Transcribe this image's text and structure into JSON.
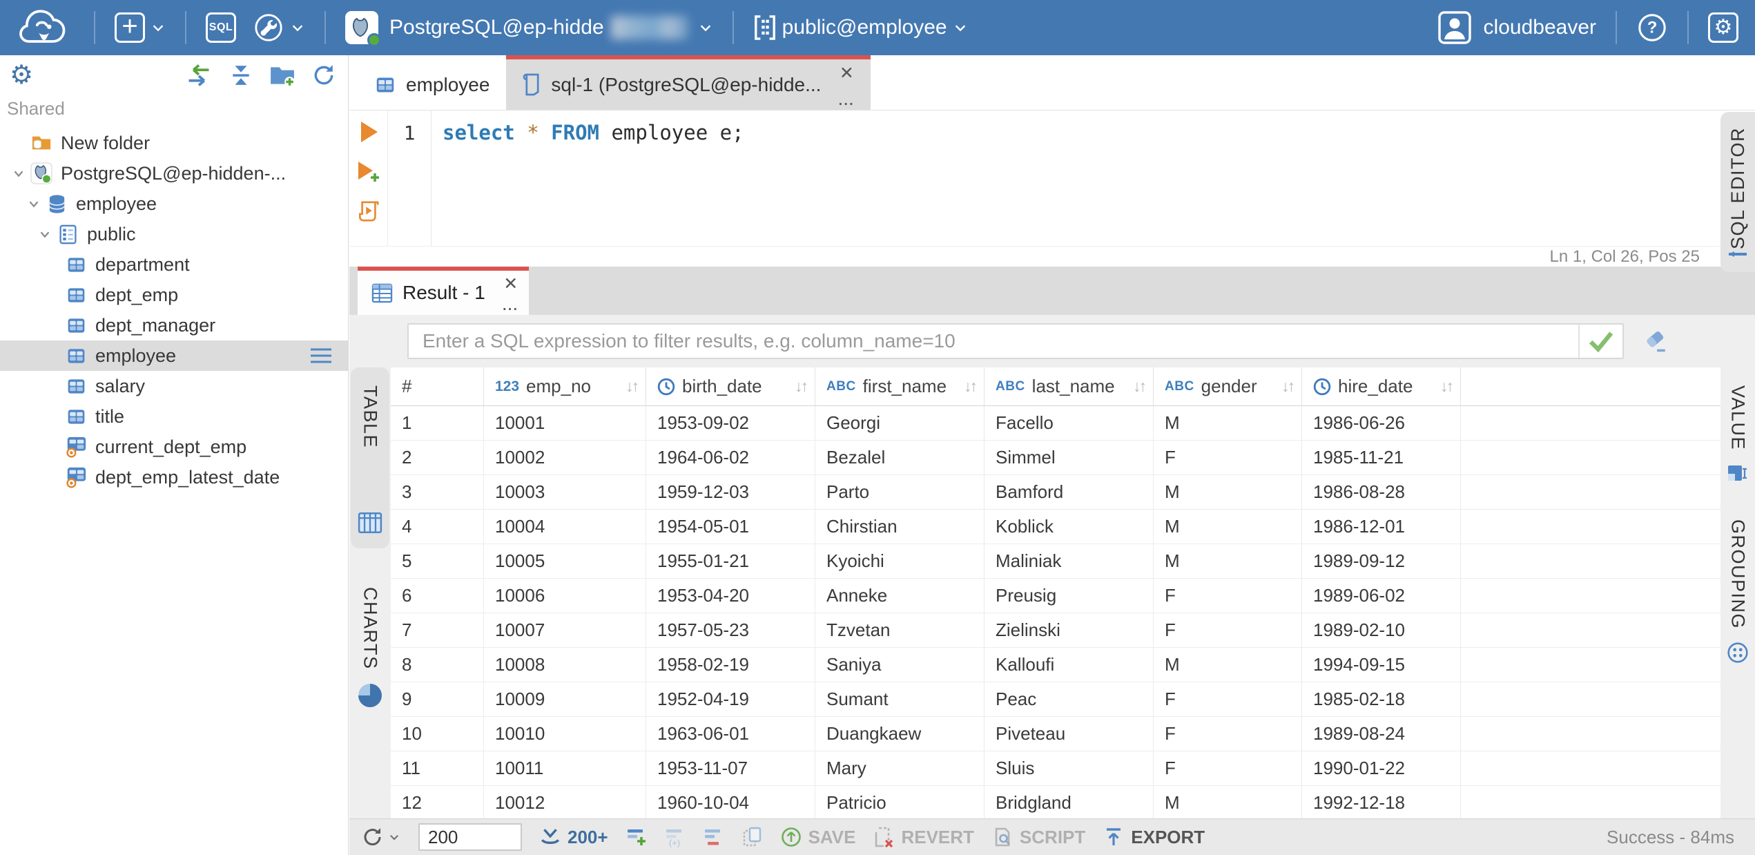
{
  "topbar": {
    "connection_label": "PostgreSQL@ep-hidde",
    "schema_label": "public@employee",
    "user_label": "cloudbeaver"
  },
  "sidebar": {
    "section_label": "Shared",
    "tree": [
      {
        "label": "New folder",
        "icon": "folder-db",
        "indent": 0,
        "chevron": false
      },
      {
        "label": "PostgreSQL@ep-hidden-...",
        "icon": "pg",
        "indent": 0,
        "chevron": true
      },
      {
        "label": "employee",
        "icon": "db",
        "indent": 1,
        "chevron": true
      },
      {
        "label": "public",
        "icon": "schema",
        "indent": 2,
        "chevron": true
      },
      {
        "label": "department",
        "icon": "table",
        "indent": 3,
        "chevron": false
      },
      {
        "label": "dept_emp",
        "icon": "table",
        "indent": 3,
        "chevron": false
      },
      {
        "label": "dept_manager",
        "icon": "table",
        "indent": 3,
        "chevron": false
      },
      {
        "label": "employee",
        "icon": "table",
        "indent": 3,
        "chevron": false,
        "selected": true
      },
      {
        "label": "salary",
        "icon": "table",
        "indent": 3,
        "chevron": false
      },
      {
        "label": "title",
        "icon": "table",
        "indent": 3,
        "chevron": false
      },
      {
        "label": "current_dept_emp",
        "icon": "view",
        "indent": 3,
        "chevron": false
      },
      {
        "label": "dept_emp_latest_date",
        "icon": "view",
        "indent": 3,
        "chevron": false
      }
    ]
  },
  "editor_tabs": {
    "employee_tab": "employee",
    "sql_tab": "sql-1 (PostgreSQL@ep-hidde...",
    "sql_tab_menu": "...",
    "close_glyph": "✕"
  },
  "editor": {
    "line_number": "1",
    "sql_tokens": [
      {
        "t": "select",
        "c": "kw"
      },
      {
        "t": " ",
        "c": ""
      },
      {
        "t": "*",
        "c": "op"
      },
      {
        "t": " ",
        "c": ""
      },
      {
        "t": "FROM",
        "c": "kw"
      },
      {
        "t": " employee e;",
        "c": ""
      }
    ],
    "status": "Ln 1, Col 26, Pos 25",
    "side_tab": "SQL EDITOR"
  },
  "result": {
    "tab_label": "Result - 1",
    "tab_menu": "...",
    "close_glyph": "✕",
    "filter_placeholder": "Enter a SQL expression to filter results, e.g. column_name=10",
    "left_tabs": {
      "table": "TABLE",
      "charts": "CHARTS"
    },
    "right_tabs": {
      "value": "VALUE",
      "grouping": "GROUPING"
    },
    "grid": {
      "columns": [
        {
          "name": "#",
          "type": "none"
        },
        {
          "name": "emp_no",
          "type": "number"
        },
        {
          "name": "birth_date",
          "type": "date"
        },
        {
          "name": "first_name",
          "type": "text"
        },
        {
          "name": "last_name",
          "type": "text"
        },
        {
          "name": "gender",
          "type": "text"
        },
        {
          "name": "hire_date",
          "type": "date"
        }
      ],
      "rows": [
        [
          "1",
          "10001",
          "1953-09-02",
          "Georgi",
          "Facello",
          "M",
          "1986-06-26"
        ],
        [
          "2",
          "10002",
          "1964-06-02",
          "Bezalel",
          "Simmel",
          "F",
          "1985-11-21"
        ],
        [
          "3",
          "10003",
          "1959-12-03",
          "Parto",
          "Bamford",
          "M",
          "1986-08-28"
        ],
        [
          "4",
          "10004",
          "1954-05-01",
          "Chirstian",
          "Koblick",
          "M",
          "1986-12-01"
        ],
        [
          "5",
          "10005",
          "1955-01-21",
          "Kyoichi",
          "Maliniak",
          "M",
          "1989-09-12"
        ],
        [
          "6",
          "10006",
          "1953-04-20",
          "Anneke",
          "Preusig",
          "F",
          "1989-06-02"
        ],
        [
          "7",
          "10007",
          "1957-05-23",
          "Tzvetan",
          "Zielinski",
          "F",
          "1989-02-10"
        ],
        [
          "8",
          "10008",
          "1958-02-19",
          "Saniya",
          "Kalloufi",
          "M",
          "1994-09-15"
        ],
        [
          "9",
          "10009",
          "1952-04-19",
          "Sumant",
          "Peac",
          "F",
          "1985-02-18"
        ],
        [
          "10",
          "10010",
          "1963-06-01",
          "Duangkaew",
          "Piveteau",
          "F",
          "1989-08-24"
        ],
        [
          "11",
          "10011",
          "1953-11-07",
          "Mary",
          "Sluis",
          "F",
          "1990-01-22"
        ],
        [
          "12",
          "10012",
          "1960-10-04",
          "Patricio",
          "Bridgland",
          "M",
          "1992-12-18"
        ]
      ]
    },
    "toolbar": {
      "row_limit": "200",
      "fetch_label": "200+",
      "save_label": "SAVE",
      "revert_label": "REVERT",
      "script_label": "SCRIPT",
      "export_label": "EXPORT",
      "status": "Success - 84ms"
    }
  },
  "colors": {
    "topbar_blue": "#4478B1",
    "accent_red": "#D9534F",
    "icon_blue": "#4F86C6",
    "exec_orange": "#E8882F",
    "success_green": "#57A33B"
  }
}
